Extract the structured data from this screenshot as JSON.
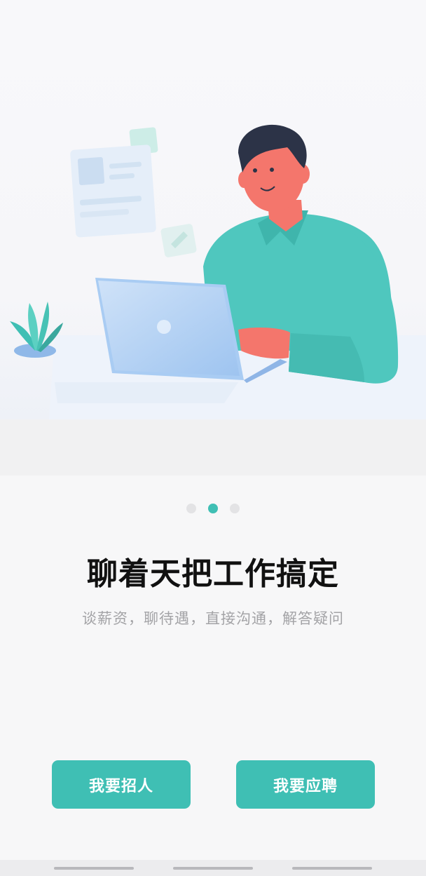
{
  "onboarding": {
    "title": "聊着天把工作搞定",
    "subtitle": "谈薪资，聊待遇，直接沟通，解答疑问",
    "page_indicator": {
      "total": 3,
      "active_index": 1
    }
  },
  "actions": {
    "recruit_label": "我要招人",
    "apply_label": "我要应聘"
  },
  "colors": {
    "accent": "#3fbfb4",
    "title": "#111111",
    "subtitle": "#a3a3a6",
    "shirt": "#4fc7be",
    "skin": "#f4766c",
    "hair": "#2c3347"
  },
  "icons": [
    "resume-illustration",
    "plant-illustration",
    "laptop-illustration",
    "person-illustration"
  ]
}
